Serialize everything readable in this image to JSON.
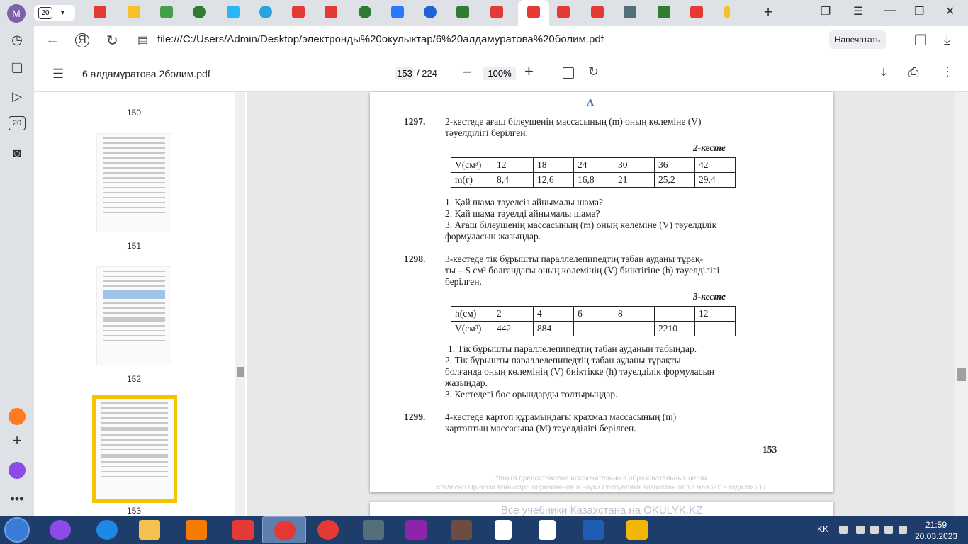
{
  "browser": {
    "profile_letter": "M",
    "tab_count": "20",
    "url": "file:///C:/Users/Admin/Desktop/электронды%20окулыктар/6%20алдамуратова%20болим.pdf",
    "print_button": "Напечатать"
  },
  "pdf_toolbar": {
    "title": "6 алдамуратова 2болим.pdf",
    "current_page": "153",
    "total_pages": "/ 224",
    "zoom": "100%"
  },
  "thumbnails": [
    {
      "label": "150"
    },
    {
      "label": "151"
    },
    {
      "label": "152"
    },
    {
      "label": "153"
    }
  ],
  "page": {
    "section_letter": "A",
    "p1297": {
      "num": "1297.",
      "line1": "2-кестеде ағаш білеушенің массасының (m) оның көлеміне (V)",
      "line2": "тәуелділігі берілген."
    },
    "table2": {
      "caption": "2-кесте",
      "rows": [
        [
          "V(см³)",
          "12",
          "18",
          "24",
          "30",
          "36",
          "42"
        ],
        [
          "m(г)",
          "8,4",
          "12,6",
          "16,8",
          "21",
          "25,2",
          "29,4"
        ]
      ]
    },
    "q1297": {
      "q1": "1. Қай шама тәуелсіз айнымалы шама?",
      "q2": "2. Қай шама тәуелді айнымалы шама?",
      "q3a": "3. Ағаш білеушенің массасының (m) оның көлеміне (V) тәуелділік",
      "q3b": "формуласын жазыңдар."
    },
    "p1298": {
      "num": "1298.",
      "line1": "3-кестеде тік бұрышты параллелепипедтің табан ауданы тұрақ-",
      "line2": "ты – S см² болғандағы оның көлемінің (V) биіктігіне (h) тәуелділігі",
      "line3": "берілген."
    },
    "table3": {
      "caption": "3-кесте",
      "rows": [
        [
          "h(см)",
          "2",
          "4",
          "6",
          "8",
          "",
          "12"
        ],
        [
          "V(см³)",
          "442",
          "884",
          "",
          "",
          "2210",
          ""
        ]
      ]
    },
    "q1298": {
      "q1": "1. Тік бұрышты параллелепипедтің табан ауданын табыңдар.",
      "q2a": "2. Тік бұрышты параллелепипедтің табан ауданы тұрақты",
      "q2b": "болғанда оның көлемінің (V) биіктікке (h) тәуелділік формуласын",
      "q2c": "жазыңдар.",
      "q3": "3. Кестедегі бос орындарды толтырыңдар."
    },
    "p1299": {
      "num": "1299.",
      "line1": "4-кестеде картоп құрамындағы крахмал массасының (m)",
      "line2": "картоптың массасына (M) тәуелділігі берілген."
    },
    "page_number": "153",
    "watermark1": "*Книга предоставлена исключительно в образовательных целях",
    "watermark2": "согласно Приказа Министра образования и науки Республики Казахстан от 17 мая 2019 года № 217",
    "next_page_banner": "Все учебники Казахстана на OKULYK.KZ"
  },
  "taskbar": {
    "language": "KK",
    "time": "21:59",
    "date": "20.03.2023"
  },
  "colors": {
    "thumbnail_highlight": "#f5c400",
    "taskbar": "#1f3d6b",
    "profile": "#7b61a8"
  }
}
